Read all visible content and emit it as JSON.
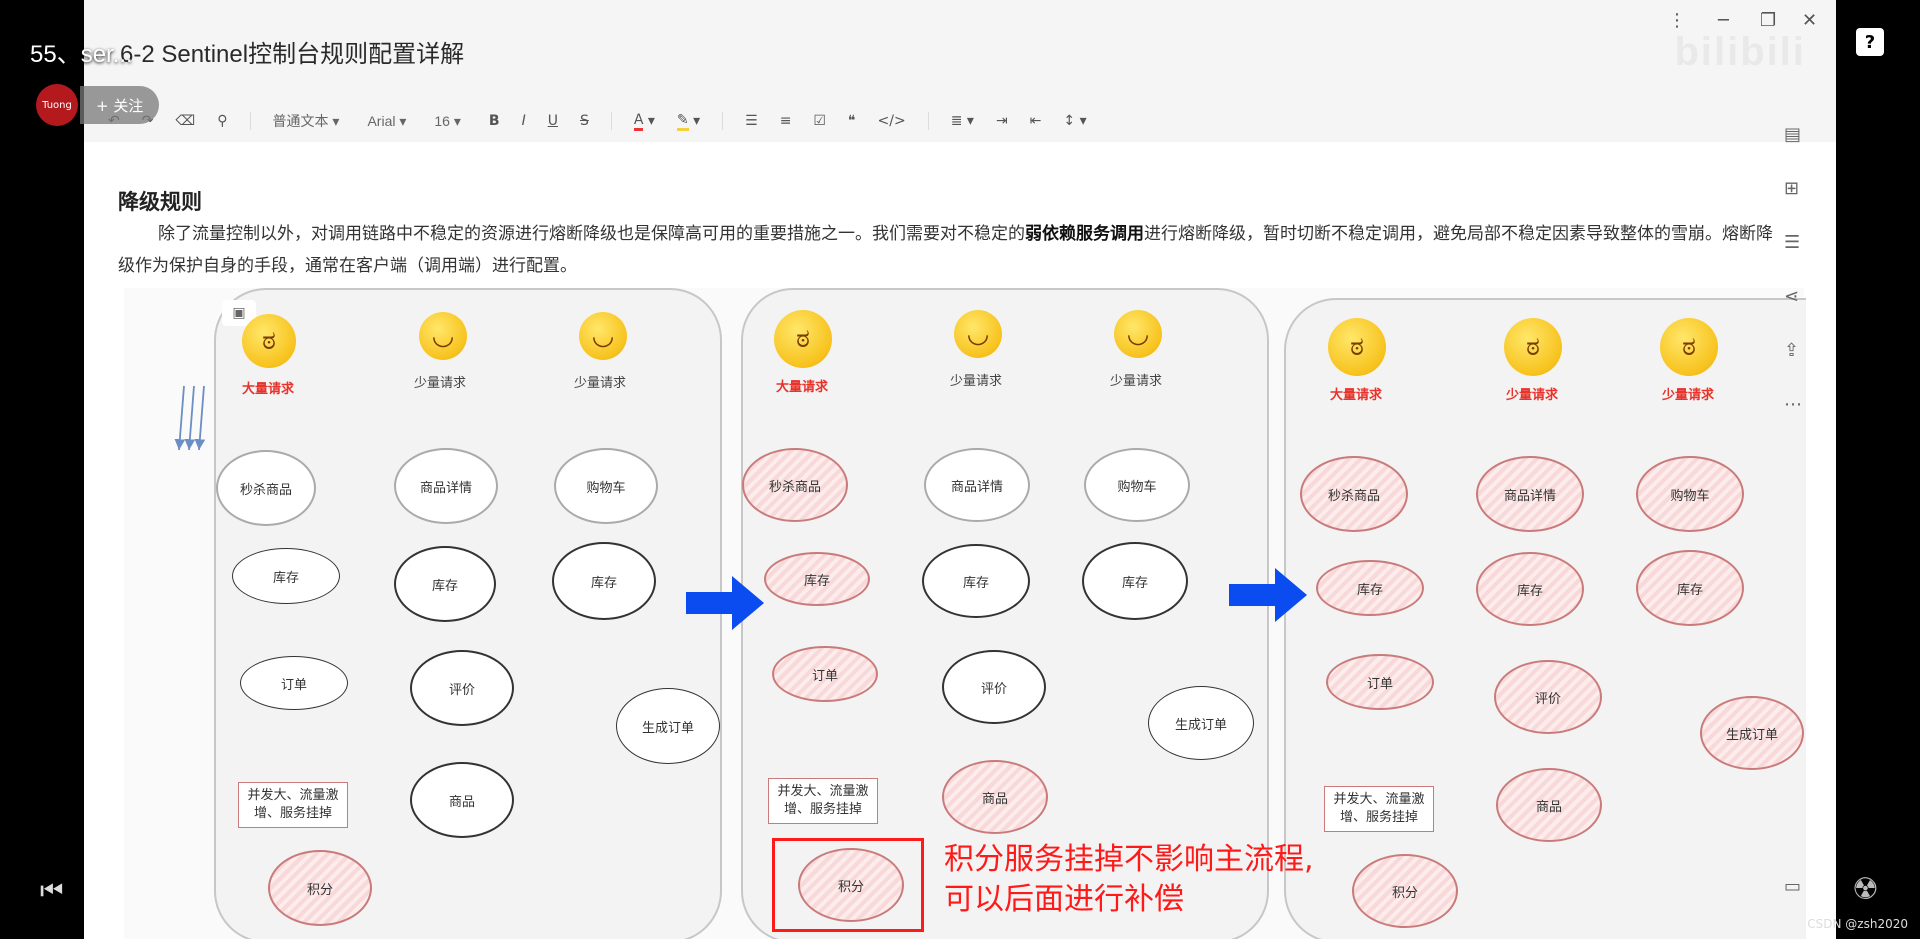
{
  "player": {
    "episode_prefix": "55、",
    "episode_title": "ser...",
    "follow_label": "+ 关注",
    "avatar_text": "Tuong",
    "help_label": "?",
    "footer_credit": "CSDN @zsh2020"
  },
  "document": {
    "title": "6-2 Sentinel控制台规则配置详解",
    "watermark": "bilibili",
    "toolbar": {
      "text_style": "普通文本",
      "font_family": "Arial",
      "font_size": "16"
    },
    "heading": "降级规则",
    "paragraph": {
      "part1": "除了流量控制以外，对调用链路中不稳定的资源进行熔断降级也是保障高可用的重要措施之一。我们需要对不稳定的",
      "bold": "弱依赖服务调用",
      "part2": "进行熔断降级，暂时切断不稳定调用，避免局部不稳定因素导致整体的雪崩。熔断降级作为保护自身的手段，通常在客户端（调用端）进行配置。"
    }
  },
  "diagram": {
    "requests": {
      "heavy": "大量请求",
      "light": "少量请求"
    },
    "nodes": {
      "seckill": "秒杀商品",
      "detail": "商品详情",
      "cart": "购物车",
      "stock": "库存",
      "order": "订单",
      "review": "评价",
      "create_order": "生成订单",
      "product": "商品",
      "points": "积分"
    },
    "callout": "并发大、流量激增、服务挂掉",
    "note_line1": "积分服务挂掉不影响主流程,",
    "note_line2": "可以后面进行补偿",
    "colors": {
      "accent_red": "#ff1a1a",
      "arrow_blue": "#0a4cf0",
      "edge_blue": "#6b8fc4"
    }
  }
}
